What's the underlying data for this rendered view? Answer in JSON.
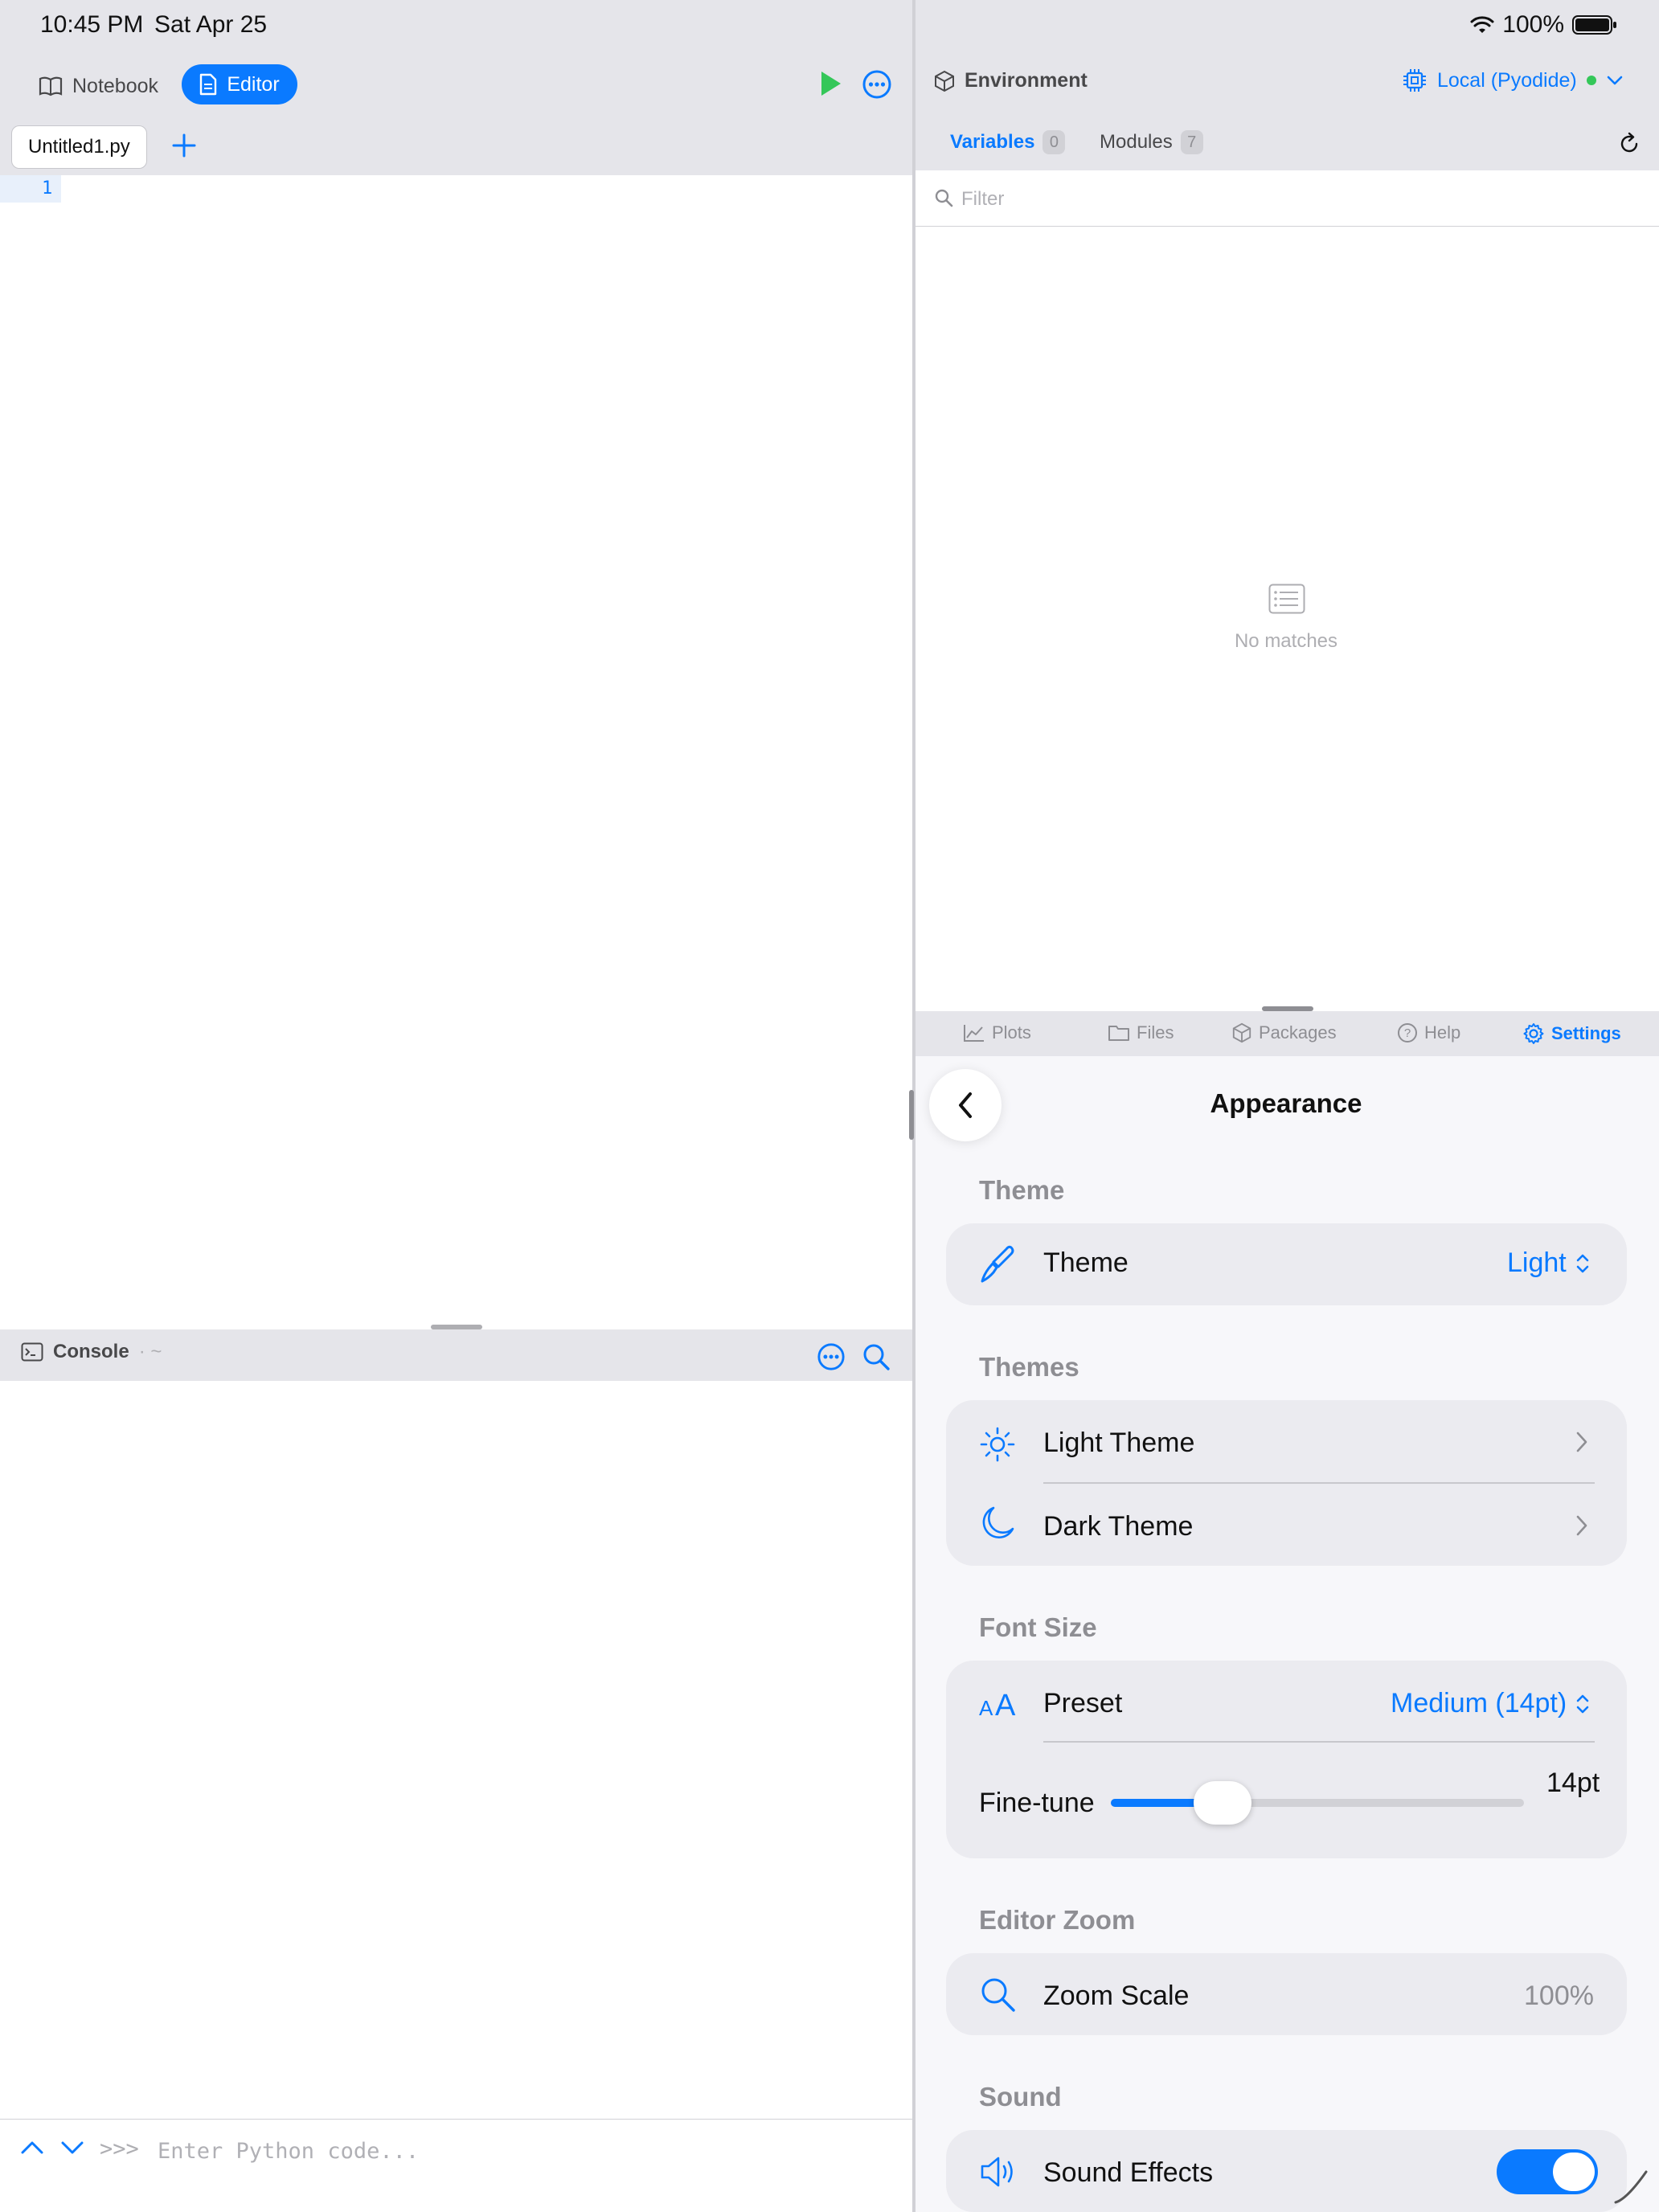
{
  "status": {
    "time": "10:45 PM",
    "date": "Sat Apr 25",
    "battery": "100%"
  },
  "left": {
    "mode_tabs": [
      {
        "label": "Notebook",
        "active": false
      },
      {
        "label": "Editor",
        "active": true
      }
    ],
    "file_tab": "Untitled1.py",
    "line_numbers": [
      "1"
    ],
    "console": {
      "title": "Console",
      "path": "· ~",
      "prompt": ">>>",
      "placeholder": "Enter Python code..."
    }
  },
  "right": {
    "environment": {
      "title": "Environment",
      "kernel": "Local (Pyodide)"
    },
    "var_tabs": {
      "variables": {
        "label": "Variables",
        "count": "0"
      },
      "modules": {
        "label": "Modules",
        "count": "7"
      }
    },
    "filter_placeholder": "Filter",
    "empty_text": "No matches",
    "bottom_tabs": {
      "plots": "Plots",
      "files": "Files",
      "packages": "Packages",
      "help": "Help",
      "settings": "Settings"
    },
    "settings": {
      "title": "Appearance",
      "sections": {
        "theme": {
          "label": "Theme",
          "row_label": "Theme",
          "value": "Light"
        },
        "themes": {
          "label": "Themes",
          "light": "Light Theme",
          "dark": "Dark Theme"
        },
        "font_size": {
          "label": "Font Size",
          "preset_label": "Preset",
          "preset_value": "Medium (14pt)",
          "finetune_label": "Fine-tune",
          "finetune_value": "14pt",
          "finetune_fraction": 0.27
        },
        "editor_zoom": {
          "label": "Editor Zoom",
          "row_label": "Zoom Scale",
          "value": "100%"
        },
        "sound": {
          "label": "Sound",
          "row_label": "Sound Effects",
          "enabled": true
        }
      }
    }
  },
  "colors": {
    "accent": "#0a7aff",
    "run": "#34c759",
    "toolbar_bg": "#e5e5ea"
  },
  "icons": [
    "book-icon",
    "document-icon",
    "play-icon",
    "ellipsis-circle-icon",
    "plus-icon",
    "terminal-icon",
    "magnifier-icon",
    "cube-icon",
    "cpu-icon",
    "chevron-down-icon",
    "refresh-icon",
    "list-icon",
    "chart-icon",
    "folder-icon",
    "package-icon",
    "question-icon",
    "gear-icon",
    "chevron-left-icon",
    "paintbrush-icon",
    "sun-icon",
    "moon-icon",
    "textformat-size-icon",
    "speaker-icon",
    "chevron-right-icon",
    "chevron-up-icon",
    "wifi-icon",
    "battery-icon"
  ]
}
